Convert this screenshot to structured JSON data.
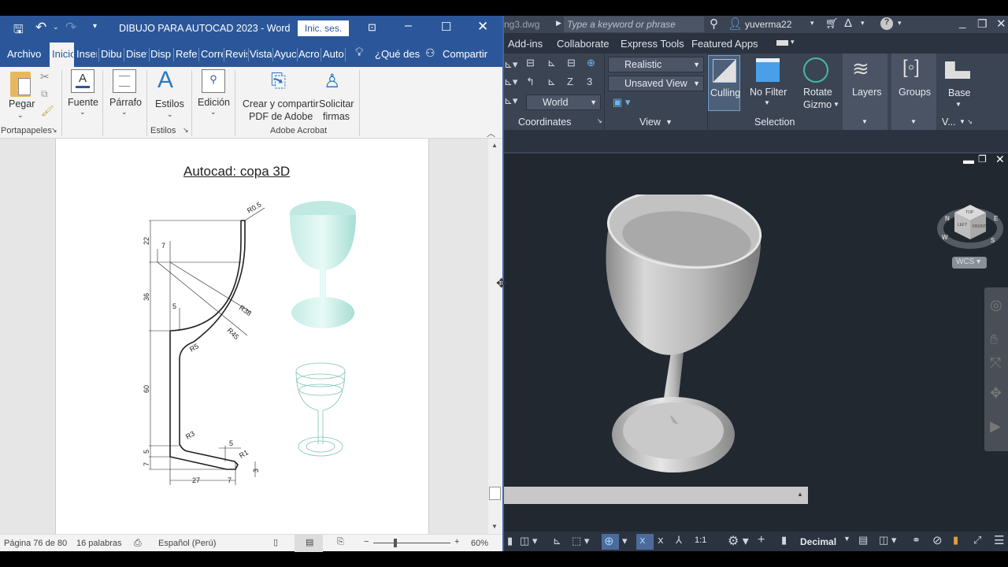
{
  "word": {
    "title": "DIBUJO PARA AUTOCAD 2023  -  Word",
    "sign_in": "Inic. ses.",
    "tabs": [
      "Archivo",
      "Inicio",
      "Inser",
      "Dibu",
      "Diseñ",
      "Disp",
      "Refer",
      "Corre",
      "Revis",
      "Vista",
      "Ayuc",
      "Acro",
      "Auto"
    ],
    "tab_labels_visible": [
      "Archivo",
      "Inicic",
      "Inser",
      "Dibu",
      "Disef",
      "Disp",
      "Refer",
      "Corre",
      "Revis",
      "Vista",
      "Ayuc",
      "Acro",
      "Auto"
    ],
    "tell_me": "¿Qué des",
    "share": "Compartir",
    "ribbon": {
      "paste": "Pegar",
      "font": "Fuente",
      "paragraph": "Párrafo",
      "styles": "Estilos",
      "editing": "Edición",
      "create_pdf_1": "Crear y compartir",
      "create_pdf_2": "PDF de Adobe",
      "request_1": "Solicitar",
      "request_2": "firmas",
      "group_clipboard": "Portapapeles",
      "group_styles": "Estilos",
      "group_acrobat": "Adobe Acrobat"
    },
    "document": {
      "heading": "Autocad: copa 3D",
      "dims": {
        "r05": "R0.5",
        "d22": "22",
        "d7a": "7",
        "d36": "36",
        "d5a": "5",
        "r38": "R38",
        "r45": "R45",
        "r5": "R5",
        "d60": "60",
        "r3": "R3",
        "d5b": "5",
        "d5c": "5",
        "r1": "R1",
        "d7b": "7",
        "d3": "3",
        "d27": "27",
        "d7c": "7"
      }
    },
    "status": {
      "page": "Página 76 de 80",
      "words": "16 palabras",
      "language": "Español (Perú)",
      "zoom": "60%"
    },
    "zoom_fraction": 0.5
  },
  "autocad": {
    "file": "ng3.dwg",
    "search_placeholder": "Type a keyword or phrase",
    "user": "yuverma22",
    "tabs": [
      "Add-ins",
      "Collaborate",
      "Express Tools",
      "Featured Apps"
    ],
    "ribbon": {
      "visual_style": "Realistic",
      "view": "Unsaved View",
      "ucs": "World",
      "culling": "Culling",
      "no_filter": "No Filter",
      "rotate_1": "Rotate",
      "rotate_2": "Gizmo",
      "layers": "Layers",
      "groups": "Groups",
      "base": "Base",
      "panel_coordinates": "Coordinates",
      "panel_view": "View",
      "panel_selection": "Selection",
      "panel_v": "V..."
    },
    "viewcube": {
      "top": "TOP",
      "left": "LEFT",
      "front": "FRONT",
      "n": "N",
      "w": "W",
      "s": "S",
      "e": "E",
      "wcs": "WCS"
    },
    "status": {
      "scale": "1:1",
      "units": "Decimal"
    }
  }
}
